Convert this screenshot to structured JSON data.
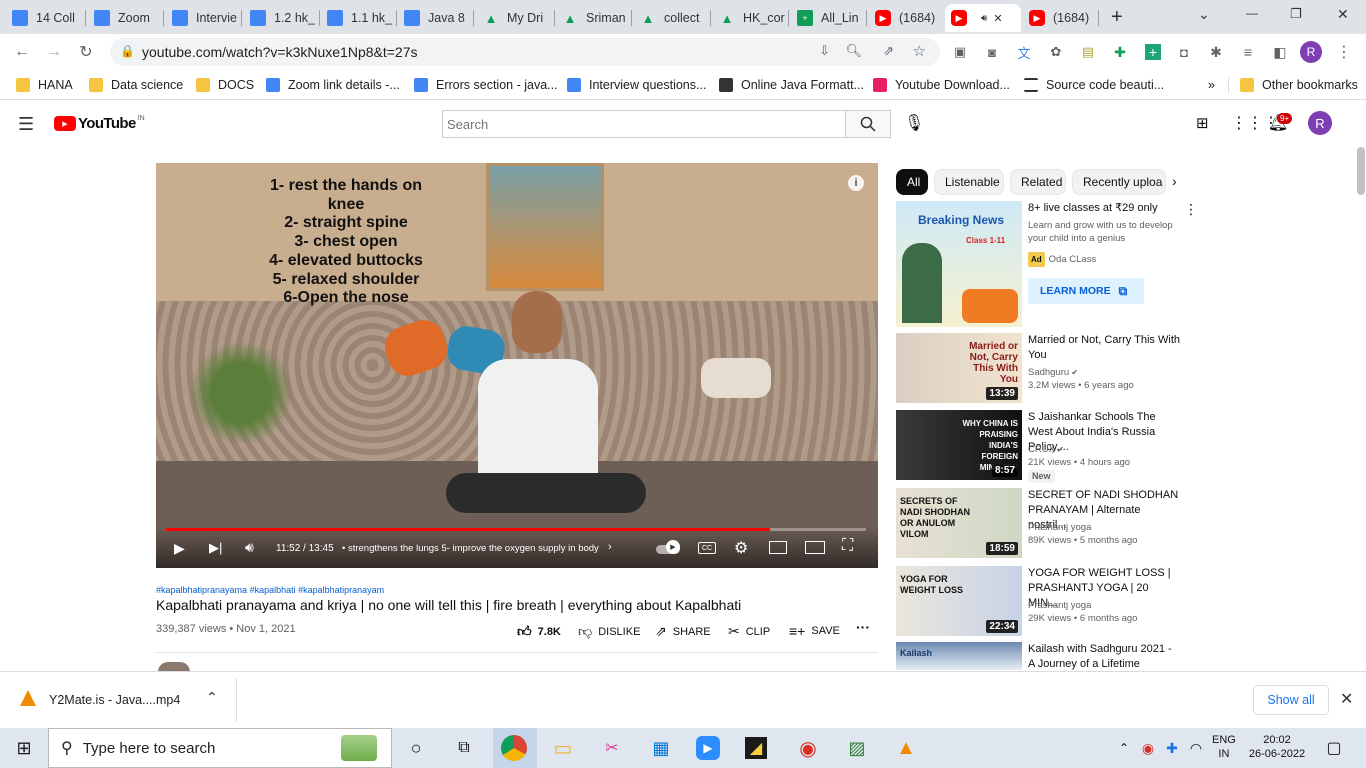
{
  "browser": {
    "tabs": [
      {
        "label": "14 Coll",
        "icon": "docs-icon"
      },
      {
        "label": "Zoom",
        "icon": "docs-icon"
      },
      {
        "label": "Intervie",
        "icon": "docs-icon"
      },
      {
        "label": "1.2 hk_",
        "icon": "docs-icon"
      },
      {
        "label": "1.1 hk_",
        "icon": "docs-icon"
      },
      {
        "label": "Java 8",
        "icon": "docs-icon"
      },
      {
        "label": "My Dri",
        "icon": "drive-icon"
      },
      {
        "label": "Sriman",
        "icon": "drive-icon"
      },
      {
        "label": "collect",
        "icon": "drive-icon"
      },
      {
        "label": "HK_cor",
        "icon": "drive-icon"
      },
      {
        "label": "All_Lin",
        "icon": "sheets-icon"
      },
      {
        "label": "(1684)",
        "icon": "youtube-icon"
      },
      {
        "label": "",
        "icon": "youtube-icon"
      },
      {
        "label": "(1684)",
        "icon": "youtube-icon"
      }
    ],
    "url": "youtube.com/watch?v=k3kNuxe1Np8&t=27s",
    "profile_initial": "R",
    "bookmarks": [
      {
        "label": "HANA",
        "icon": "folder-icon"
      },
      {
        "label": "Data science",
        "icon": "folder-icon"
      },
      {
        "label": "DOCS",
        "icon": "folder-icon"
      },
      {
        "label": "Zoom link details -...",
        "icon": "docs-icon"
      },
      {
        "label": "Errors section - java...",
        "icon": "docs-icon"
      },
      {
        "label": "Interview questions...",
        "icon": "docs-icon"
      },
      {
        "label": "Online Java Formatt...",
        "icon": "td-icon"
      },
      {
        "label": "Youtube Download...",
        "icon": "download-icon"
      },
      {
        "label": "Source code beauti...",
        "icon": "menu-icon"
      }
    ],
    "overflow": "»",
    "other_bookmarks": "Other bookmarks"
  },
  "youtube": {
    "logo_text": "YouTube",
    "region": "IN",
    "search_placeholder": "Search",
    "notif_count": "9+",
    "avatar_initial": "R",
    "video": {
      "overlay_lines": "1- rest the hands on\nknee\n2- straight spine\n3- chest open\n4- elevated buttocks\n5- relaxed shoulder\n6-Open  the nose",
      "time": "11:52 / 13:45",
      "chapter": "• strengthens the lungs 5- improve the oxygen supply in body",
      "progress": 0.863,
      "hashtags": "#kapalbhatipranayama #kapalbhati #kapalbhatipranayam",
      "title": "Kapalbhati pranayama and kriya | no one will tell this | fire breath | everything about Kapalbhati",
      "views_date": "339,387 views • Nov 1, 2021",
      "likes": "7.8K",
      "dislike": "DISLIKE",
      "share": "SHARE",
      "clip": "CLIP",
      "save": "SAVE"
    },
    "chips": [
      "All",
      "Listenable",
      "Related",
      "Recently uploa"
    ],
    "ad": {
      "title": "8+ live classes at ₹29 only",
      "desc": "Learn and grow with us to develop your child into a genius",
      "badge": "Ad",
      "advertiser": "Oda CLass",
      "cta": "LEARN MORE",
      "thumb_heading": "Breaking News",
      "thumb_sub": "Class 1-11"
    },
    "recs": [
      {
        "title": "Married or Not, Carry This With You",
        "channel": "Sadhguru",
        "meta": "3.2M views • 6 years ago",
        "duration": "13:39",
        "thumb_text": "Married or Not, Carry This With You",
        "new": ""
      },
      {
        "title": "S Jaishankar Schools The West About India's Russia Policy,...",
        "channel": "CRUX",
        "meta": "21K views • 4 hours ago",
        "duration": "8:57",
        "thumb_text": "WHY CHINA IS PRAISING INDIA'S FOREIGN MINISTER",
        "new": "New"
      },
      {
        "title": "SECRET OF NADI SHODHAN PRANAYAM | Alternate nostril...",
        "channel": "Prashantj yoga",
        "meta": "89K views • 5 months ago",
        "duration": "18:59",
        "thumb_text": "SECRETS OF NADI SHODHAN OR ANULOM VILOM",
        "new": ""
      },
      {
        "title": "YOGA FOR WEIGHT LOSS | PRASHANTJ YOGA | 20 MIN...",
        "channel": "Prashantj yoga",
        "meta": "29K views • 6 months ago",
        "duration": "22:34",
        "thumb_text": "YOGA FOR WEIGHT LOSS",
        "new": ""
      },
      {
        "title": "Kailash with Sadhguru 2021 - A Journey of a Lifetime",
        "channel": "",
        "meta": "",
        "duration": "",
        "thumb_text": "Kailash",
        "new": ""
      }
    ]
  },
  "download": {
    "filename": "Y2Mate.is - Java....mp4",
    "show_all": "Show all"
  },
  "taskbar": {
    "search_placeholder": "Type here to search",
    "lang_top": "ENG",
    "lang_bottom": "IN",
    "time": "20:02",
    "date": "26-06-2022"
  }
}
